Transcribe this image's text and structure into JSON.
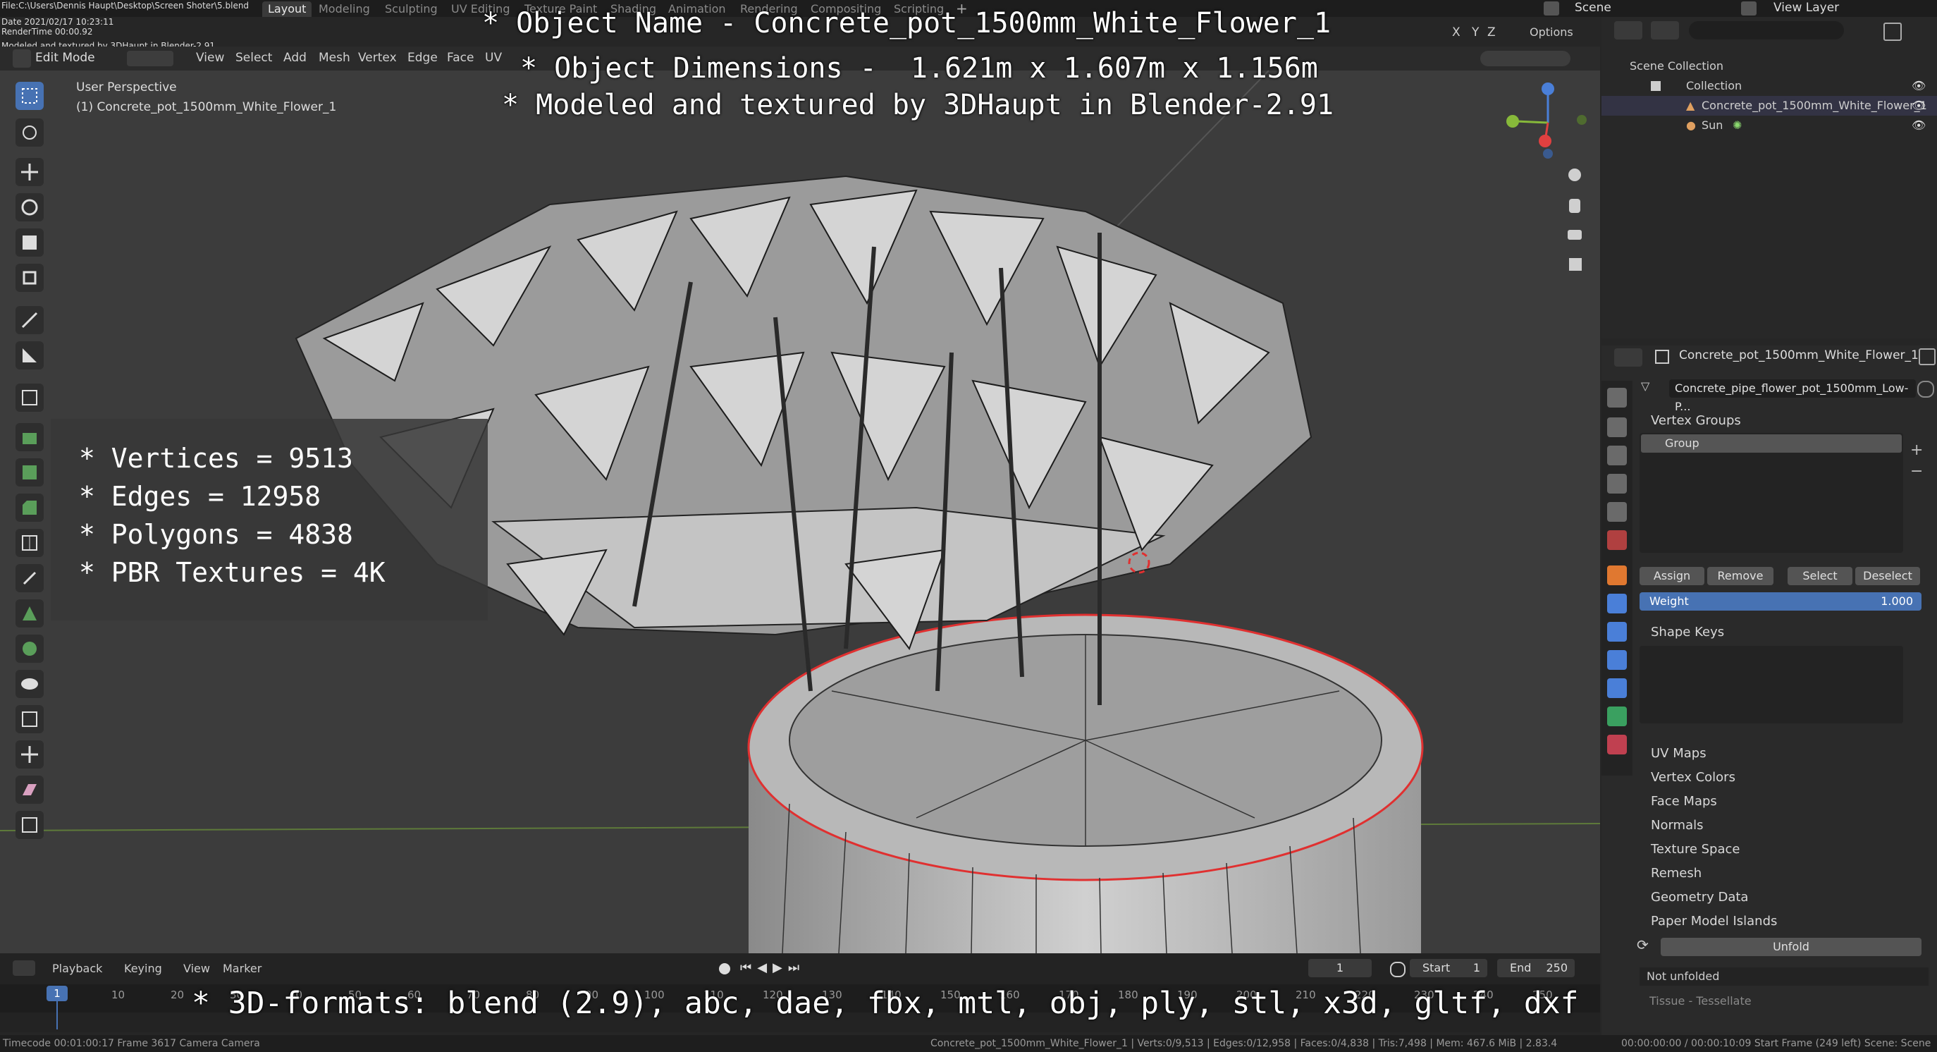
{
  "file_info": {
    "line1": "File:C:\\Users\\Dennis Haupt\\Desktop\\Screen Shoter\\5.blend",
    "line2": "Date 2021/02/17 10:23:11",
    "line3": "RenderTime 00:00.92",
    "line4": "Modeled and textured by 3DHaupt in Blender-2.91"
  },
  "workspace_tabs": [
    "Layout",
    "Modeling",
    "Sculpting",
    "UV Editing",
    "Texture Paint",
    "Shading",
    "Animation",
    "Rendering",
    "Compositing",
    "Scripting"
  ],
  "active_workspace": "Layout",
  "scene": "Scene",
  "view_layer": "View Layer",
  "header": {
    "mode": "Edit Mode",
    "menus": [
      "View",
      "Select",
      "Add",
      "Mesh",
      "Vertex",
      "Edge",
      "Face",
      "UV"
    ],
    "axis_x": "X",
    "axis_y": "Y",
    "axis_z": "Z",
    "options": "Options"
  },
  "viewport": {
    "perspective": "User Perspective",
    "object_label": "(1) Concrete_pot_1500mm_White_Flower_1"
  },
  "overlay": {
    "title_lines": [
      "* Object Name - Concrete_pot_1500mm_White_Flower_1",
      "* Object Dimensions -  1.621m x 1.607m x 1.156m",
      "* Modeled and textured by 3DHaupt in Blender-2.91"
    ],
    "stats": [
      "* Vertices = 9513",
      "* Edges = 12958",
      "* Polygons = 4838",
      "* PBR Textures = 4K"
    ],
    "formats": "* 3D-formats: blend (2.9), abc, dae, fbx, mtl, obj, ply, stl, x3d, gltf, dxf"
  },
  "outliner": {
    "title": "Scene Collection",
    "collection": "Collection",
    "object": "Concrete_pot_1500mm_White_Flower_1",
    "light": "Sun"
  },
  "properties": {
    "object_name": "Concrete_pot_1500mm_White_Flower_1",
    "mesh_name": "Concrete_pipe_flower_pot_1500mm_Low-P...",
    "vertex_groups": "Vertex Groups",
    "group_item": "Group",
    "assign": "Assign",
    "remove": "Remove",
    "select": "Select",
    "deselect": "Deselect",
    "weight_label": "Weight",
    "weight_value": "1.000",
    "shape_keys": "Shape Keys",
    "panels": [
      "UV Maps",
      "Vertex Colors",
      "Face Maps",
      "Normals",
      "Texture Space",
      "Remesh",
      "Geometry Data"
    ],
    "paper_model": "Paper Model Islands",
    "unfold": "Unfold",
    "not_unfolded": "Not unfolded",
    "tissue": "Tissue - Tessellate"
  },
  "timeline": {
    "playback": "Playback",
    "keying": "Keying",
    "view": "View",
    "marker": "Marker",
    "current_frame": "1",
    "start_label": "Start",
    "start_value": "1",
    "end_label": "End",
    "end_value": "250",
    "ticks": [
      "10",
      "20",
      "30",
      "40",
      "50",
      "60",
      "70",
      "80",
      "90",
      "100",
      "110",
      "120",
      "130",
      "140",
      "150",
      "160",
      "170",
      "180",
      "190",
      "200",
      "210",
      "220",
      "230",
      "240",
      "250"
    ],
    "frame_marker": "1"
  },
  "statusbar": {
    "left": "Timecode 00:01:00:17   Frame 3617   Camera Camera",
    "center": "Concrete_pot_1500mm_White_Flower_1 | Verts:0/9,513 | Edges:0/12,958 | Faces:0/4,838 | Tris:7,498 | Mem: 467.6 MiB | 2.83.4",
    "right": "00:00:00:00 / 00:00:10:09    Start Frame (249 left)   Scene: Scene"
  },
  "colors": {
    "accent": "#4772b3",
    "weight_bar": "#4772b3",
    "selection_red": "#e03030"
  }
}
